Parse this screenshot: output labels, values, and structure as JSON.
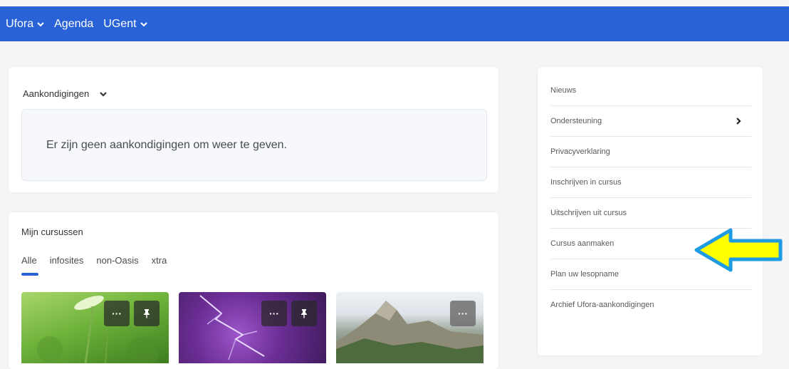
{
  "topnav": {
    "items": [
      "Ufora",
      "Agenda",
      "UGent"
    ]
  },
  "announcements": {
    "title": "Aankondigingen",
    "empty_message": "Er zijn geen aankondigingen om weer te geven."
  },
  "courses": {
    "title": "Mijn cursussen",
    "tabs": [
      "Alle",
      "infosites",
      "non-Oasis",
      "xtra"
    ],
    "active_tab": "Alle",
    "tiles": [
      {
        "image": "green-sprout",
        "menu_icon": "more-icon",
        "pin_icon": "pin-icon"
      },
      {
        "image": "purple-lightning",
        "menu_icon": "more-icon",
        "pin_icon": "pin-icon"
      },
      {
        "image": "rocky-mountain",
        "menu_icon": "more-icon"
      }
    ]
  },
  "sidebar": {
    "items": [
      "Nieuws",
      "Ondersteuning",
      "Privacyverklaring",
      "Inschrijven in cursus",
      "Uitschrijven uit cursus",
      "Cursus aanmaken",
      "Plan uw lesopname",
      "Archief Ufora-aankondigingen"
    ]
  },
  "colors": {
    "topbar": "#2862d6",
    "arrow_fill": "#ffff00",
    "arrow_stroke": "#1e9be3"
  }
}
